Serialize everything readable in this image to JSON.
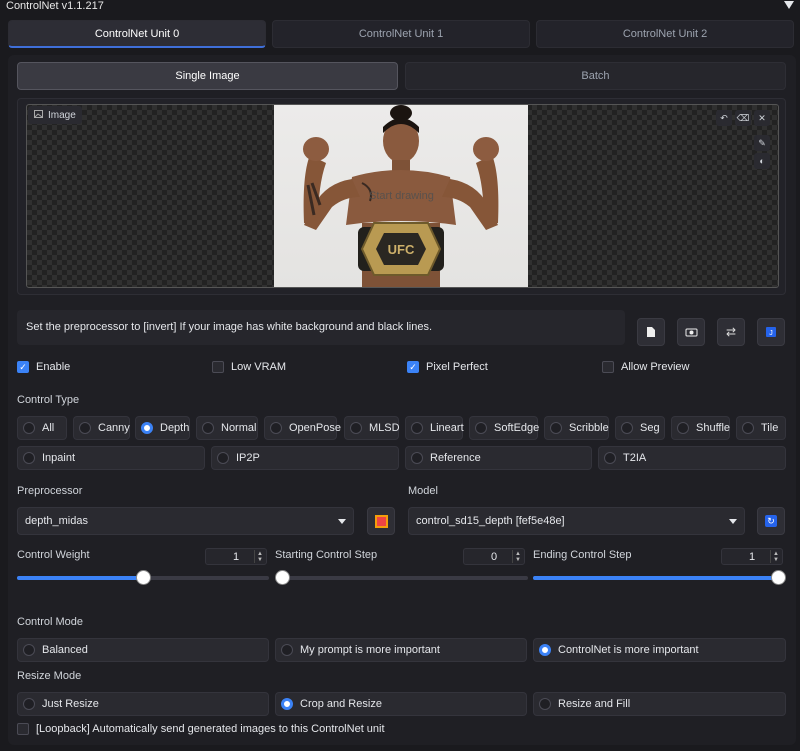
{
  "window": {
    "title": "ControlNet v1.1.217"
  },
  "unit_tabs": [
    {
      "label": "ControlNet Unit 0",
      "active": true
    },
    {
      "label": "ControlNet Unit 1",
      "active": false
    },
    {
      "label": "ControlNet Unit 2",
      "active": false
    }
  ],
  "mode_tabs": [
    {
      "label": "Single Image",
      "active": true
    },
    {
      "label": "Batch",
      "active": false
    }
  ],
  "image": {
    "label": "Image",
    "placeholder": "Start drawing",
    "belt_text": "UFC"
  },
  "hint": "Set the preprocessor to [invert] If your image has white background and black lines.",
  "toggles": {
    "enable": {
      "label": "Enable",
      "checked": true
    },
    "low_vram": {
      "label": "Low VRAM",
      "checked": false
    },
    "pixel_perfect": {
      "label": "Pixel Perfect",
      "checked": true
    },
    "allow_preview": {
      "label": "Allow Preview",
      "checked": false
    }
  },
  "control_type": {
    "label": "Control Type",
    "options": [
      "All",
      "Canny",
      "Depth",
      "Normal",
      "OpenPose",
      "MLSD",
      "Lineart",
      "SoftEdge",
      "Scribble",
      "Seg",
      "Shuffle",
      "Tile",
      "Inpaint",
      "IP2P",
      "Reference",
      "T2IA"
    ],
    "selected": "Depth"
  },
  "preprocessor": {
    "label": "Preprocessor",
    "value": "depth_midas"
  },
  "model": {
    "label": "Model",
    "value": "control_sd15_depth [fef5e48e]"
  },
  "sliders": {
    "control_weight": {
      "label": "Control Weight",
      "value": "1",
      "fraction": 0.5
    },
    "start_step": {
      "label": "Starting Control Step",
      "value": "0",
      "fraction": 0.0
    },
    "end_step": {
      "label": "Ending Control Step",
      "value": "1",
      "fraction": 1.0
    }
  },
  "control_mode": {
    "label": "Control Mode",
    "options": [
      "Balanced",
      "My prompt is more important",
      "ControlNet is more important"
    ],
    "selected": "ControlNet is more important"
  },
  "resize_mode": {
    "label": "Resize Mode",
    "options": [
      "Just Resize",
      "Crop and Resize",
      "Resize and Fill"
    ],
    "selected": "Crop and Resize"
  },
  "loopback": {
    "label": "[Loopback] Automatically send generated images to this ControlNet unit",
    "checked": false
  },
  "colors": {
    "accent": "#3b82f6",
    "background": "#1a1a1e"
  },
  "icons": [
    "triangle-down-icon",
    "image-icon",
    "undo-icon",
    "erase-icon",
    "close-icon",
    "brush-icon",
    "palette-icon",
    "document-icon",
    "camera-icon",
    "swap-icon",
    "send-icon",
    "explosion-icon",
    "refresh-icon"
  ]
}
